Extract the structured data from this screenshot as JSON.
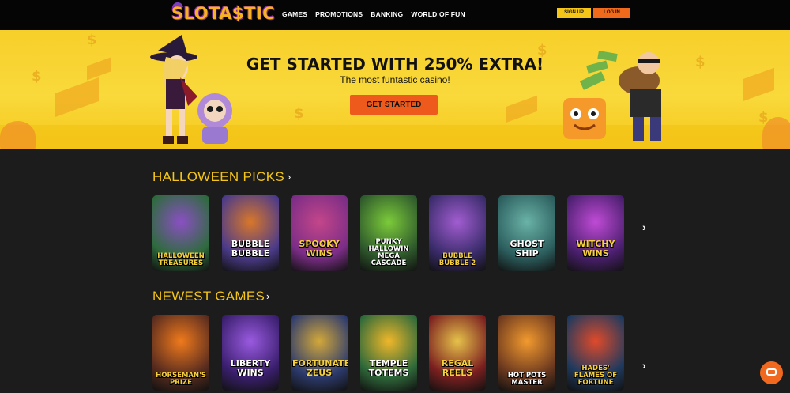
{
  "header": {
    "logo": "SLOTA$TIC",
    "nav": [
      "GAMES",
      "PROMOTIONS",
      "BANKING",
      "WORLD OF FUN"
    ],
    "signup_label": "SIGN UP",
    "login_label": "LOG IN"
  },
  "hero": {
    "title": "GET STARTED WITH 250% EXTRA!",
    "subtitle": "The most funtastic casino!",
    "cta": "GET STARTED"
  },
  "sections": [
    {
      "title": "HALLOWEEN PICKS",
      "chevron": "›",
      "games": [
        {
          "title": "HALLOWEEN TREASURES",
          "bg": "#2e6b3d",
          "accent": "#8b4fc4"
        },
        {
          "title": "BUBBLE BUBBLE",
          "bg": "#4b3b8a",
          "accent": "#d9772a"
        },
        {
          "title": "SPOOKY WINS",
          "bg": "#7b2d86",
          "accent": "#c4468a"
        },
        {
          "title": "PUNKY HALLOWIN MEGA CASCADE",
          "bg": "#2f5a2c",
          "accent": "#7ccb3a"
        },
        {
          "title": "BUBBLE BUBBLE 2",
          "bg": "#3a2c6b",
          "accent": "#a25dd1"
        },
        {
          "title": "GHOST SHIP",
          "bg": "#2c5e5e",
          "accent": "#6ab3a8"
        },
        {
          "title": "WITCHY WINS",
          "bg": "#4a1f6e",
          "accent": "#c04bd6"
        }
      ]
    },
    {
      "title": "NEWEST GAMES",
      "chevron": "›",
      "games": [
        {
          "title": "HORSEMAN'S PRIZE",
          "bg": "#5a2d1f",
          "accent": "#f07a1c"
        },
        {
          "title": "LIBERTY WINS",
          "bg": "#3a1f6e",
          "accent": "#9a5ae0"
        },
        {
          "title": "FORTUNATE ZEUS",
          "bg": "#2d3b6e",
          "accent": "#d3a83a"
        },
        {
          "title": "TEMPLE TOTEMS",
          "bg": "#2f6a3a",
          "accent": "#f0b72a"
        },
        {
          "title": "REGAL REELS",
          "bg": "#7b1f1f",
          "accent": "#e6c24a"
        },
        {
          "title": "HOT POTS MASTER",
          "bg": "#6e3a1f",
          "accent": "#f29a2e"
        },
        {
          "title": "HADES' FLAMES OF FORTUNE",
          "bg": "#1f3a5e",
          "accent": "#e04a2a"
        }
      ]
    }
  ],
  "row_arrow": "›"
}
